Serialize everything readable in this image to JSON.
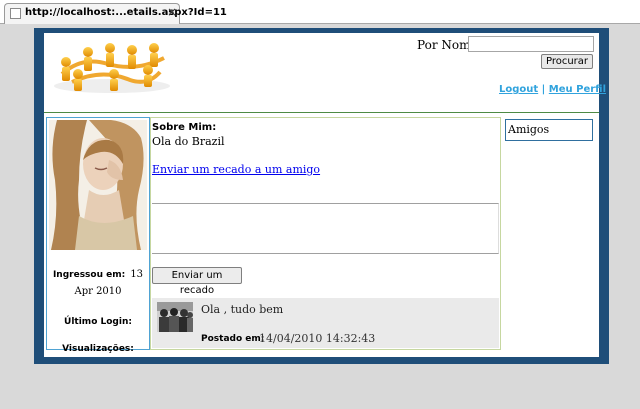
{
  "browser": {
    "tab_title": "http://localhost:...etails.aspx?Id=11",
    "tab_icon": "page-icon",
    "close_glyph": "×"
  },
  "colors": {
    "frame": "#1f4e79",
    "link": "#31a3dd",
    "profile_border": "#4fa3d3",
    "main_border": "#c6d7a0",
    "scrap_bg": "#eaeaea"
  },
  "header": {
    "logo_icon": "people-network-logo",
    "search_label": "Por Nome:",
    "search_value": "",
    "search_button": "Procurar",
    "logout_link": "Logout",
    "separator": "|",
    "profile_link": "Meu Perfil"
  },
  "profile": {
    "photo_icon": "user-photo",
    "joined_label": "Ingressou em:",
    "joined_value": "13 Apr 2010",
    "last_login_label": "Último Login:",
    "views_label": "Visualizações:"
  },
  "main": {
    "about_heading": "Sobre Mim:",
    "about_text": "Ola do Brazil",
    "send_friend_link": "Enviar um recado a um amigo",
    "message_value": "",
    "send_button": "Enviar um recado",
    "scrap": {
      "avatar_icon": "group-photo",
      "text": "Ola , tudo bem",
      "posted_label": "Postado em:",
      "posted_date": "14/04/2010 14:32:43"
    }
  },
  "friends": {
    "title": "Amigos"
  }
}
